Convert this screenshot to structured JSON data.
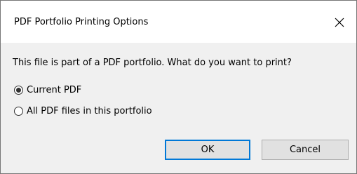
{
  "window": {
    "title": "PDF Portfolio Printing Options",
    "close_icon": "close-icon"
  },
  "content": {
    "prompt": "This file is part of a PDF portfolio. What do you want to print?",
    "options": [
      {
        "label": "Current PDF",
        "selected": true
      },
      {
        "label": "All PDF files in this portfolio",
        "selected": false
      }
    ]
  },
  "buttons": {
    "ok_label": "OK",
    "cancel_label": "Cancel"
  },
  "colors": {
    "accent": "#0078d7",
    "dialog_bg": "#f0f0f0",
    "button_bg": "#e1e1e1"
  }
}
